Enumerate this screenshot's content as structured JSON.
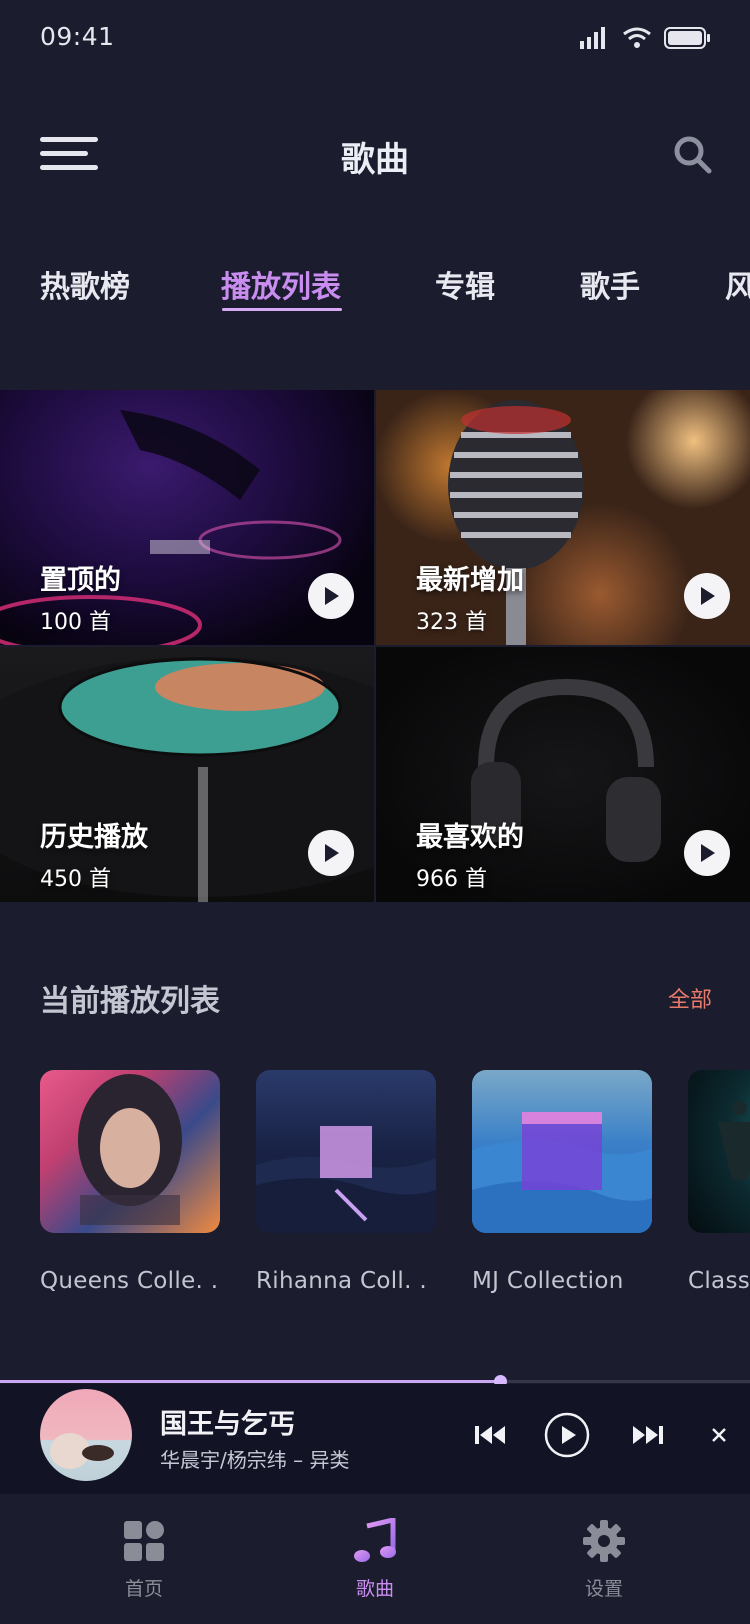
{
  "status_bar": {
    "time": "09:41"
  },
  "header": {
    "title": "歌曲"
  },
  "tabs": [
    {
      "label": "热歌榜",
      "active": false
    },
    {
      "label": "播放列表",
      "active": true
    },
    {
      "label": "专辑",
      "active": false
    },
    {
      "label": "歌手",
      "active": false
    },
    {
      "label": "风",
      "active": false
    }
  ],
  "playlists": [
    {
      "title": "置顶的",
      "count": "100 首"
    },
    {
      "title": "最新增加",
      "count": "323 首"
    },
    {
      "title": "历史播放",
      "count": "450 首"
    },
    {
      "title": "最喜欢的",
      "count": "966 首"
    }
  ],
  "current_section": {
    "title": "当前播放列表",
    "all_label": "全部"
  },
  "albums": [
    {
      "name": "Queens Colle. ."
    },
    {
      "name": "Rihanna Coll. ."
    },
    {
      "name": "MJ Collection"
    },
    {
      "name": "Classi"
    }
  ],
  "now_playing": {
    "title": "国王与乞丐",
    "artist": "华晨宇/杨宗纬 – 异类",
    "progress": 0.667
  },
  "nav": [
    {
      "label": "首页",
      "active": false
    },
    {
      "label": "歌曲",
      "active": true
    },
    {
      "label": "设置",
      "active": false
    }
  ],
  "colors": {
    "accent": "#c98df0",
    "link": "#e87a6a",
    "background": "#1b1d2e"
  }
}
